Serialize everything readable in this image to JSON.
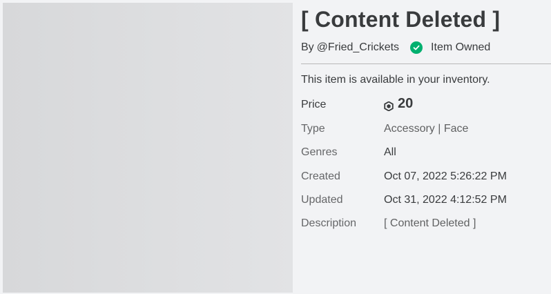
{
  "item": {
    "title": "[ Content Deleted ]",
    "by_prefix": "By",
    "creator": "@Fried_Crickets",
    "owned_label": "Item Owned",
    "availability": "This item is available in your inventory."
  },
  "details": {
    "price_label": "Price",
    "price_value": "20",
    "type_label": "Type",
    "type_value": "Accessory | Face",
    "genres_label": "Genres",
    "genres_value": "All",
    "created_label": "Created",
    "created_value": "Oct 07, 2022 5:26:22 PM",
    "updated_label": "Updated",
    "updated_value": "Oct 31, 2022 4:12:52 PM",
    "description_label": "Description",
    "description_value": "[ Content Deleted ]"
  },
  "icons": {
    "owned": "check-circle-icon",
    "currency": "robux-icon"
  },
  "colors": {
    "owned_green": "#00b06f",
    "background": "#f2f3f5",
    "thumbnail": "#dcdddf"
  }
}
